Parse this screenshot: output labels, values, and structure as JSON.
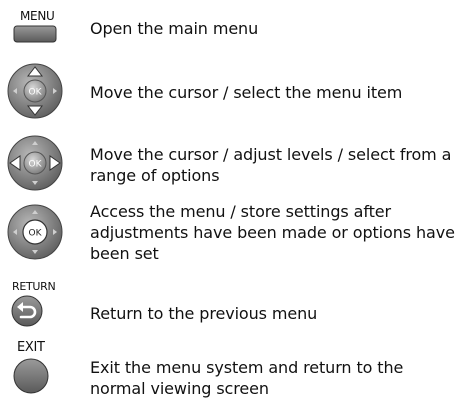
{
  "rows": [
    {
      "button_label": "MENU",
      "icon": "menu-button-icon",
      "text": "Open the main menu"
    },
    {
      "icon": "dpad-up-down-icon",
      "text": "Move the cursor / select the menu item"
    },
    {
      "icon": "dpad-left-right-icon",
      "text": "Move the cursor / adjust levels / select from a range of options"
    },
    {
      "icon": "ok-button-icon",
      "text": "Access the menu / store settings after adjustments have been made or options have been set"
    },
    {
      "button_label": "RETURN",
      "icon": "return-button-icon",
      "text": "Return to the previous menu"
    },
    {
      "button_label": "EXIT",
      "icon": "exit-button-icon",
      "text": "Exit the menu system and return to the normal viewing screen"
    }
  ],
  "ok_label": "OK",
  "colors": {
    "button_gray": "#7a7a7a",
    "ring_gray": "#9a9a9a",
    "text": "#111111"
  }
}
